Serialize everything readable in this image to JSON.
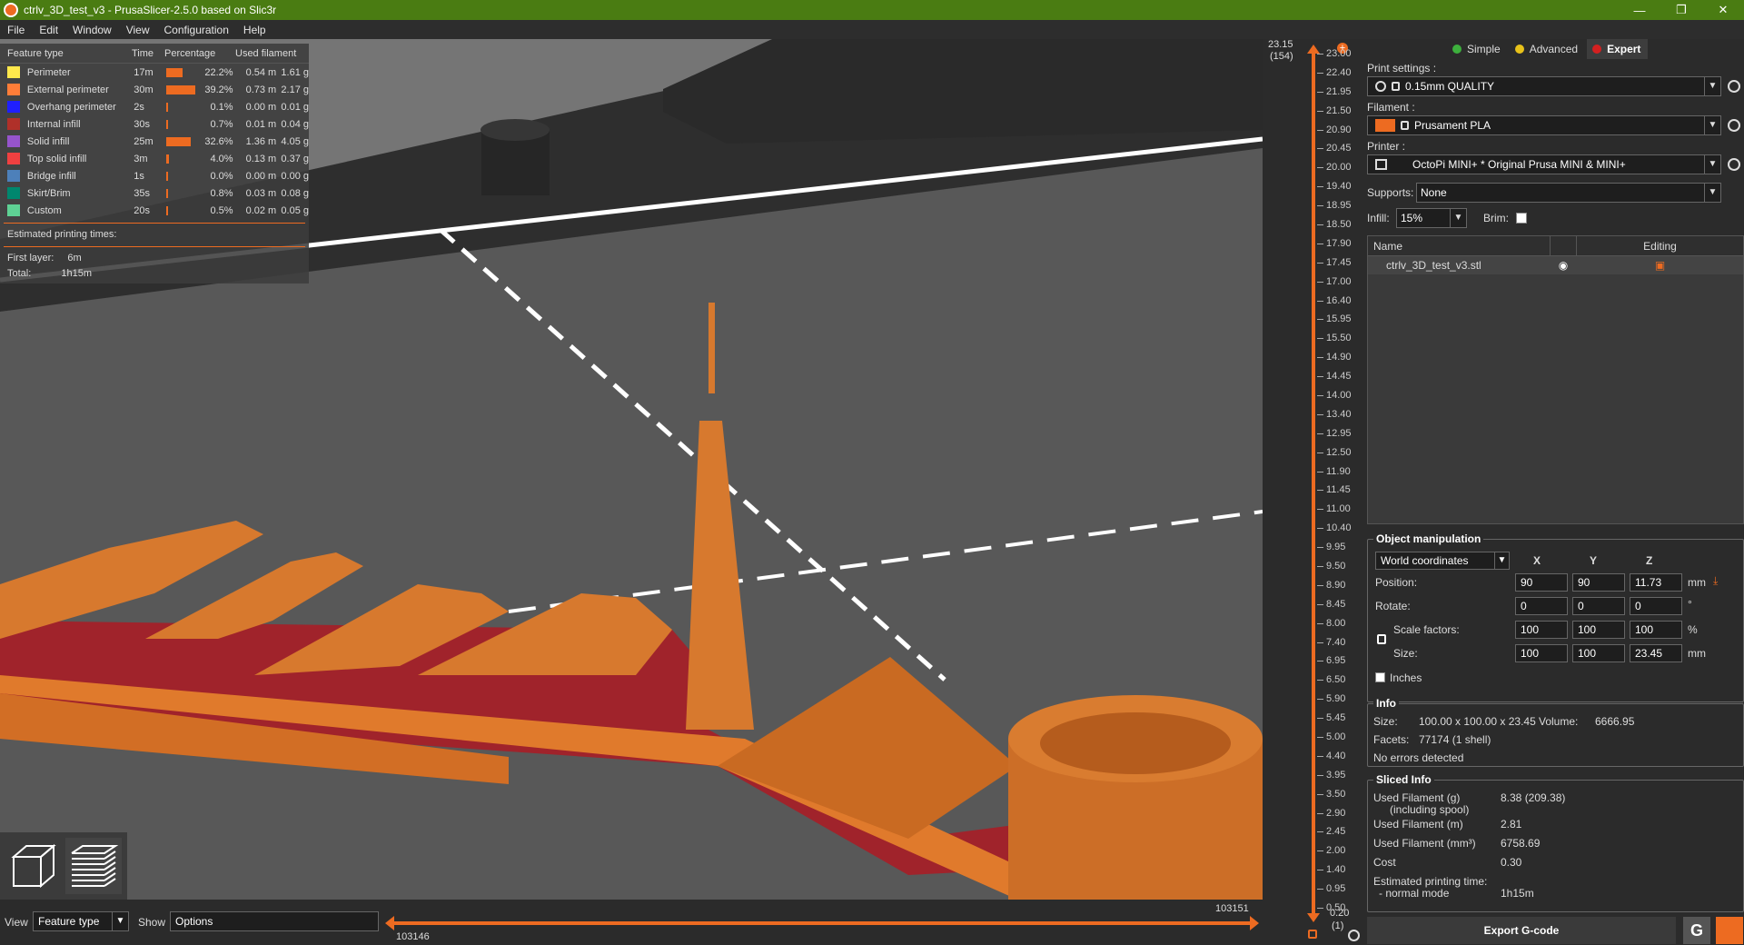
{
  "window": {
    "title": "ctrlv_3D_test_v3 - PrusaSlicer-2.5.0 based on Slic3r",
    "controls": [
      "—",
      "❐",
      "✕"
    ]
  },
  "menu": [
    "File",
    "Edit",
    "Window",
    "View",
    "Configuration",
    "Help"
  ],
  "legend": {
    "headers": {
      "feature": "Feature type",
      "time": "Time",
      "pct": "Percentage",
      "used": "Used filament"
    },
    "rows": [
      {
        "name": "Perimeter",
        "color": "#FFE84C",
        "time": "17m",
        "pct_value": 22.2,
        "pct": "22.2%",
        "m": "0.54 m",
        "g": "1.61 g"
      },
      {
        "name": "External perimeter",
        "color": "#FF7D38",
        "time": "30m",
        "pct_value": 39.2,
        "pct": "39.2%",
        "m": "0.73 m",
        "g": "2.17 g"
      },
      {
        "name": "Overhang perimeter",
        "color": "#1F1FFF",
        "time": "2s",
        "pct_value": 0.1,
        "pct": "0.1%",
        "m": "0.00 m",
        "g": "0.01 g"
      },
      {
        "name": "Internal infill",
        "color": "#B03029",
        "time": "30s",
        "pct_value": 0.7,
        "pct": "0.7%",
        "m": "0.01 m",
        "g": "0.04 g"
      },
      {
        "name": "Solid infill",
        "color": "#9654CC",
        "time": "25m",
        "pct_value": 32.6,
        "pct": "32.6%",
        "m": "1.36 m",
        "g": "4.05 g"
      },
      {
        "name": "Top solid infill",
        "color": "#F04040",
        "time": "3m",
        "pct_value": 4.0,
        "pct": "4.0%",
        "m": "0.13 m",
        "g": "0.37 g"
      },
      {
        "name": "Bridge infill",
        "color": "#4D80BA",
        "time": "1s",
        "pct_value": 0.0,
        "pct": "0.0%",
        "m": "0.00 m",
        "g": "0.00 g"
      },
      {
        "name": "Skirt/Brim",
        "color": "#00876E",
        "time": "35s",
        "pct_value": 0.8,
        "pct": "0.8%",
        "m": "0.03 m",
        "g": "0.08 g"
      },
      {
        "name": "Custom",
        "color": "#5ED194",
        "time": "20s",
        "pct_value": 0.5,
        "pct": "0.5%",
        "m": "0.02 m",
        "g": "0.05 g"
      }
    ],
    "est_title": "Estimated printing times:",
    "first_layer_label": "First layer:",
    "first_layer": "6m",
    "total_label": "Total:",
    "total": "1h15m"
  },
  "bottom": {
    "view_label": "View",
    "view_value": "Feature type",
    "show_label": "Show",
    "show_value": "Options",
    "slider_right": "103151",
    "slider_left": "103146"
  },
  "vslider": {
    "top_value": "23.15",
    "top_count": "(154)",
    "bottom_value": "0.20",
    "bottom_count": "(1)",
    "ticks": [
      "23.00",
      "22.40",
      "21.95",
      "21.50",
      "20.90",
      "20.45",
      "20.00",
      "19.40",
      "18.95",
      "18.50",
      "17.90",
      "17.45",
      "17.00",
      "16.40",
      "15.95",
      "15.50",
      "14.90",
      "14.45",
      "14.00",
      "13.40",
      "12.95",
      "12.50",
      "11.90",
      "11.45",
      "11.00",
      "10.40",
      "9.95",
      "9.50",
      "8.90",
      "8.45",
      "8.00",
      "7.40",
      "6.95",
      "6.50",
      "5.90",
      "5.45",
      "5.00",
      "4.40",
      "3.95",
      "3.50",
      "2.90",
      "2.45",
      "2.00",
      "1.40",
      "0.95",
      "0.50"
    ]
  },
  "sidebar": {
    "modes": [
      {
        "label": "Simple",
        "color": "#3db03d"
      },
      {
        "label": "Advanced",
        "color": "#e8c21a"
      },
      {
        "label": "Expert",
        "color": "#d42020"
      }
    ],
    "print_settings_label": "Print settings :",
    "print_settings": "0.15mm QUALITY",
    "filament_label": "Filament :",
    "filament": "Prusament PLA",
    "filament_color": "#ED6B21",
    "printer_label": "Printer :",
    "printer": "OctoPi MINI+ * Original Prusa MINI & MINI+",
    "supports_label": "Supports:",
    "supports": "None",
    "infill_label": "Infill:",
    "infill": "15%",
    "brim_label": "Brim:",
    "objlist": {
      "col_name": "Name",
      "col_editing": "Editing",
      "object": "ctrlv_3D_test_v3.stl"
    },
    "manip": {
      "title": "Object manipulation",
      "coords": "World coordinates",
      "x": "X",
      "y": "Y",
      "z": "Z",
      "position_label": "Position:",
      "position": [
        "90",
        "90",
        "11.73"
      ],
      "position_unit": "mm",
      "rotate_label": "Rotate:",
      "rotate": [
        "0",
        "0",
        "0"
      ],
      "rotate_unit": "°",
      "scale_label": "Scale factors:",
      "scale": [
        "100",
        "100",
        "100"
      ],
      "scale_unit": "%",
      "size_label": "Size:",
      "size": [
        "100",
        "100",
        "23.45"
      ],
      "size_unit": "mm",
      "inches_label": "Inches"
    },
    "info": {
      "title": "Info",
      "size_label": "Size:",
      "size": "100.00 x 100.00 x 23.45",
      "volume_label": "Volume:",
      "volume": "6666.95",
      "facets_label": "Facets:",
      "facets": "77174 (1 shell)",
      "errors": "No errors detected"
    },
    "sliced": {
      "title": "Sliced Info",
      "rows": [
        {
          "label": "Used Filament (g)",
          "sub": "(including spool)",
          "value": "8.38 (209.38)"
        },
        {
          "label": "Used Filament (m)",
          "value": "2.81"
        },
        {
          "label": "Used Filament (mm³)",
          "value": "6758.69"
        },
        {
          "label": "Cost",
          "value": "0.30"
        },
        {
          "label": "Estimated printing time:",
          "sub": "- normal mode",
          "value": "1h15m"
        }
      ]
    },
    "export_label": "Export G-code"
  }
}
